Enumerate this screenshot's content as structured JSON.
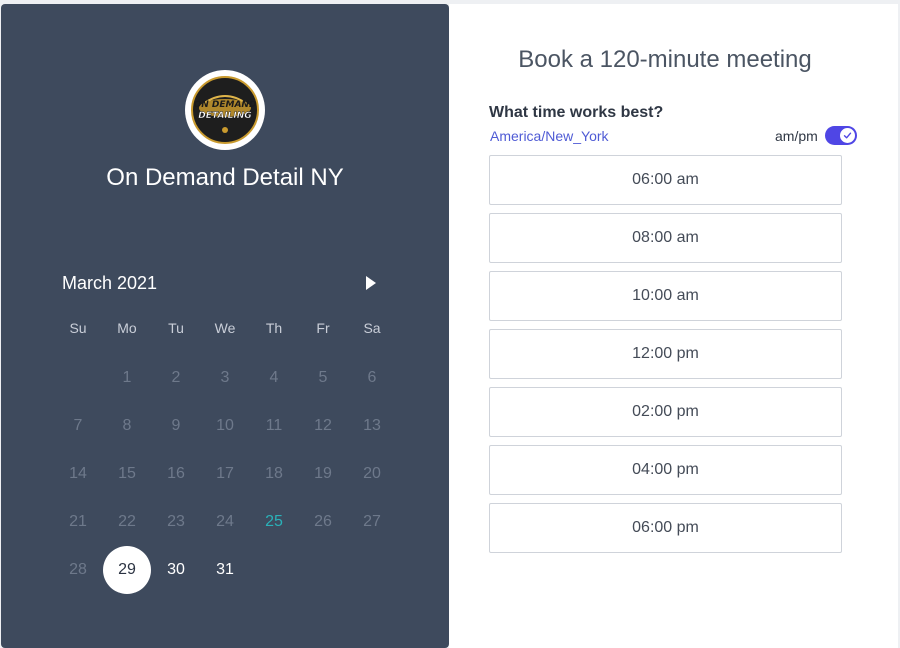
{
  "organization": {
    "name": "On Demand Detail NY",
    "logo_text_line1": "ON DEMAND",
    "logo_text_line2": "DETAILING"
  },
  "calendar": {
    "month_label": "March 2021",
    "weekdays": [
      "Su",
      "Mo",
      "Tu",
      "We",
      "Th",
      "Fr",
      "Sa"
    ],
    "weeks": [
      [
        "",
        "1",
        "2",
        "3",
        "4",
        "5",
        "6"
      ],
      [
        "7",
        "8",
        "9",
        "10",
        "11",
        "12",
        "13"
      ],
      [
        "14",
        "15",
        "16",
        "17",
        "18",
        "19",
        "20"
      ],
      [
        "21",
        "22",
        "23",
        "24",
        "25",
        "26",
        "27"
      ],
      [
        "28",
        "29",
        "30",
        "31",
        "",
        "",
        ""
      ]
    ],
    "today": "25",
    "selected": "29",
    "available": [
      "29",
      "30",
      "31"
    ],
    "colors": {
      "panel": "#3e4a5d",
      "disabled_day": "#6e798b",
      "today": "#2ab1b8",
      "selected_bg": "#ffffff"
    }
  },
  "booking": {
    "title": "Book a 120-minute meeting",
    "question": "What time works best?",
    "timezone": "America/New_York",
    "ampm_label": "am/pm",
    "ampm_enabled": true,
    "accent_color": "#4f46e5",
    "time_slots": [
      "06:00 am",
      "08:00 am",
      "10:00 am",
      "12:00 pm",
      "02:00 pm",
      "04:00 pm",
      "06:00 pm"
    ]
  }
}
